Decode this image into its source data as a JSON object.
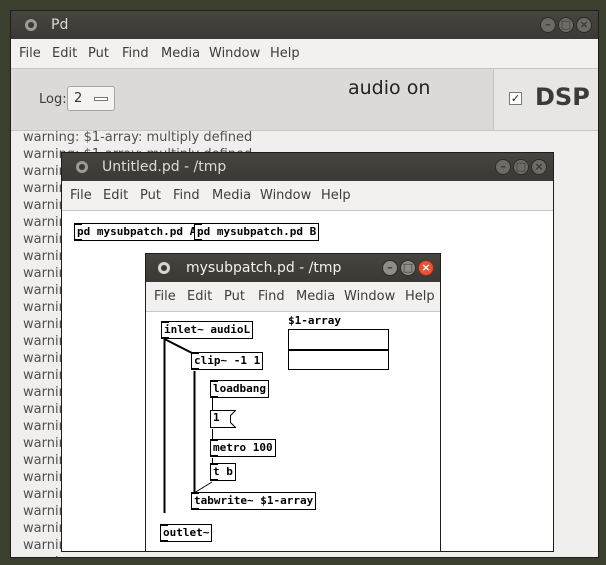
{
  "main_window": {
    "title": "Pd",
    "menu": [
      "File",
      "Edit",
      "Put",
      "Find",
      "Media",
      "Window",
      "Help"
    ],
    "log_label": "Log:",
    "log_value": "2",
    "audio_status": "audio on",
    "dsp_label": "DSP",
    "dsp_checked": true,
    "log_lines": [
      "warning: $1-array: multiply defined",
      "warning: $1-array: multiply defined",
      "warning",
      "warning",
      "warning",
      "warning",
      "warning",
      "warning",
      "warning",
      "warning",
      "warning",
      "warning",
      "warning",
      "warning",
      "warning",
      "warning",
      "warning",
      "warning",
      "warning",
      "warning",
      "warning",
      "warning",
      "warning",
      "warning",
      "warning",
      "warning"
    ]
  },
  "untitled_window": {
    "title": "Untitled.pd  - /tmp",
    "menu": [
      "File",
      "Edit",
      "Put",
      "Find",
      "Media",
      "Window",
      "Help"
    ],
    "objects": [
      "pd mysubpatch.pd A",
      "pd mysubpatch.pd B"
    ]
  },
  "subpatch_window": {
    "title": "mysubpatch.pd  - /tmp",
    "menu": [
      "File",
      "Edit",
      "Put",
      "Find",
      "Media",
      "Window",
      "Help"
    ],
    "array_label": "$1-array",
    "objects": {
      "inlet": "inlet~ audioL",
      "clip": "clip~ -1 1",
      "loadbang": "loadbang",
      "msg": "1",
      "metro": "metro 100",
      "tb": "t b",
      "tabwrite": "tabwrite~ $1-array",
      "outlet": "outlet~"
    }
  }
}
